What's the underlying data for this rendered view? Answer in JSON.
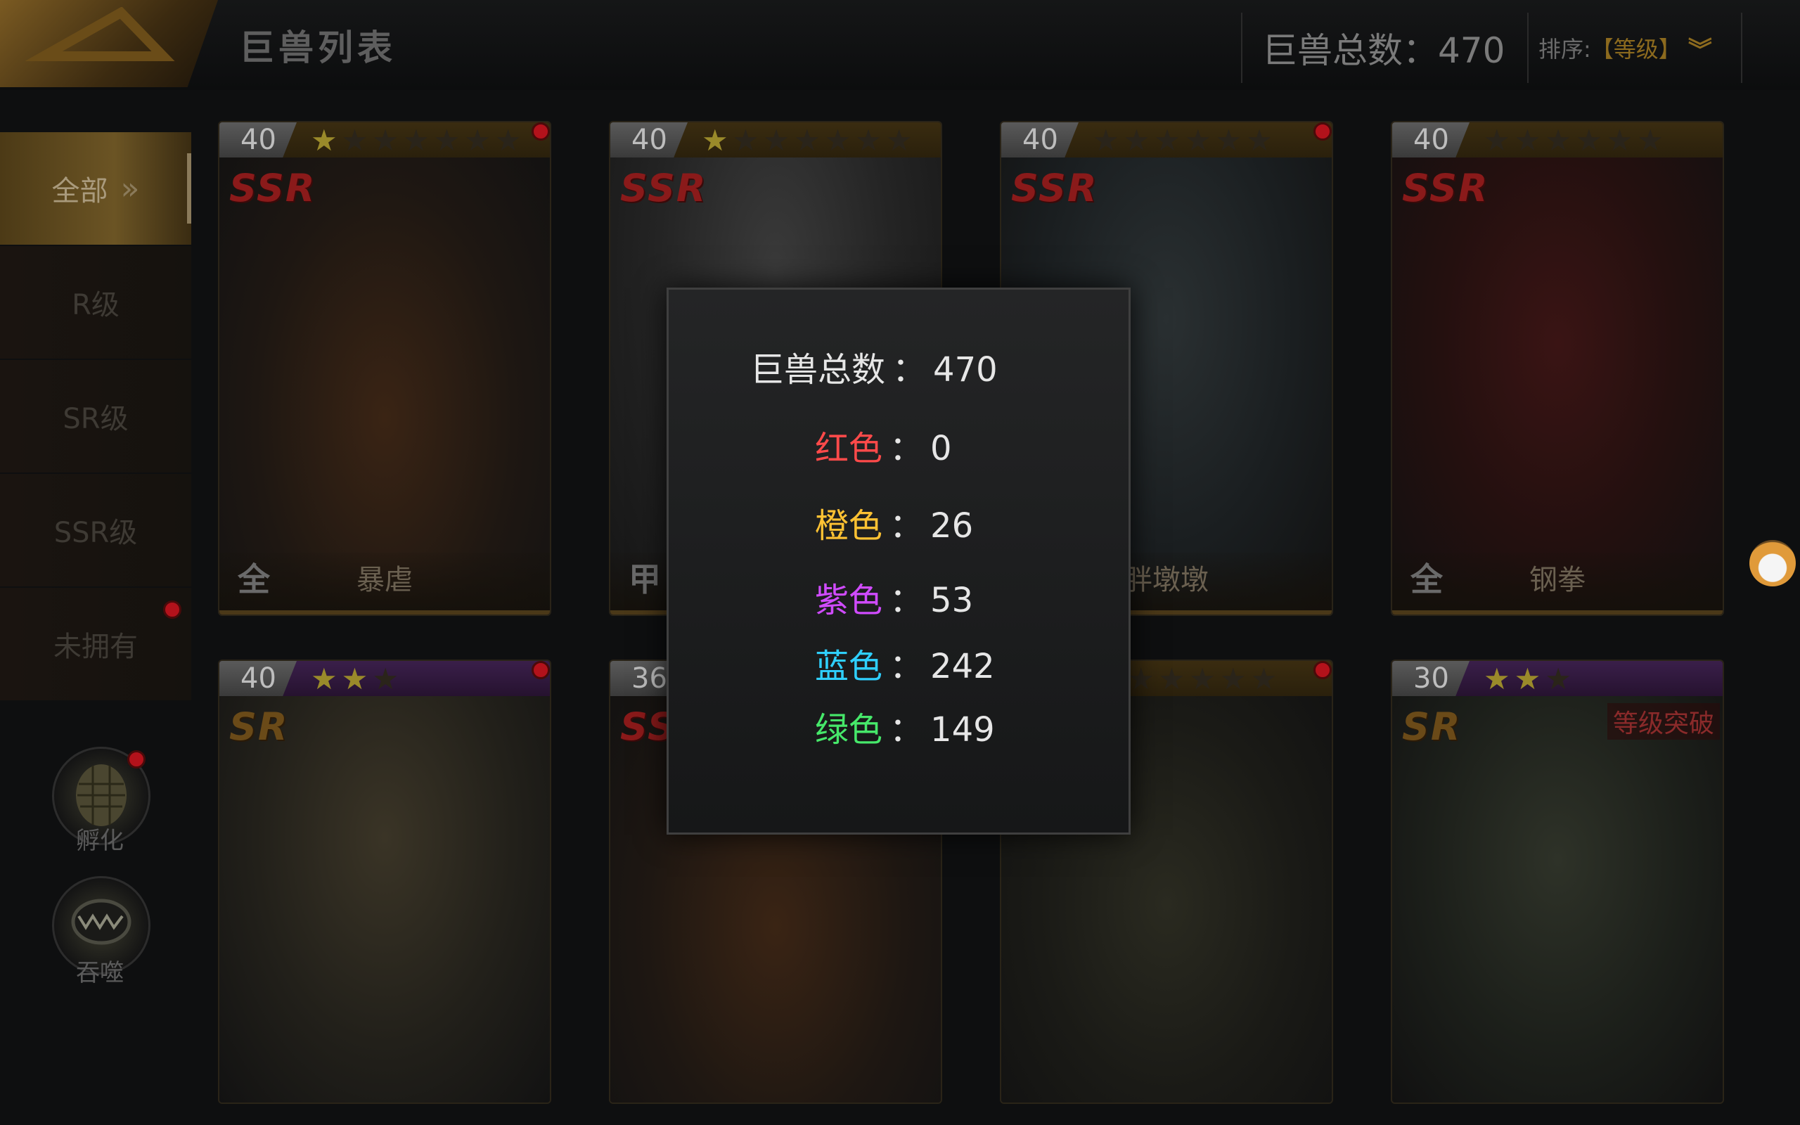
{
  "header": {
    "title": "巨兽列表",
    "total_text": "巨兽总数：470",
    "sort_label": "排序:",
    "sort_value": "【等级】"
  },
  "sidebar": {
    "items": [
      {
        "label": "全部"
      },
      {
        "label": "R级"
      },
      {
        "label": "SR级"
      },
      {
        "label": "SSR级"
      },
      {
        "label": "未拥有"
      }
    ],
    "hatch_label": "孵化",
    "devour_label": "吞噬"
  },
  "cards": [
    {
      "level": "40",
      "rank": "SSR",
      "stars_on": "★",
      "stars_off": "★★★★★★",
      "tag": "全",
      "name": "暴虐"
    },
    {
      "level": "40",
      "rank": "SSR",
      "stars_on": "★",
      "stars_off": "★★★★★★",
      "tag": "甲",
      "name": ""
    },
    {
      "level": "40",
      "rank": "SSR",
      "stars_on": "",
      "stars_off": "★★★★★★",
      "tag": "",
      "name": "胖墩墩"
    },
    {
      "level": "40",
      "rank": "SSR",
      "stars_on": "",
      "stars_off": "★★★★★★",
      "tag": "全",
      "name": "钢拳"
    },
    {
      "level": "40",
      "rank": "SR",
      "stars_on": "★★",
      "stars_off": "★",
      "tag": "",
      "name": ""
    },
    {
      "level": "36",
      "rank": "SSR",
      "stars_on": "",
      "stars_off": "",
      "tag": "",
      "name": ""
    },
    {
      "level": "",
      "rank": "",
      "stars_on": "",
      "stars_off": "★★★★★",
      "tag": "",
      "name": ""
    },
    {
      "level": "30",
      "rank": "SR",
      "stars_on": "★★",
      "stars_off": "★",
      "tag": "",
      "name": "",
      "badge": "等级突破"
    }
  ],
  "popup": {
    "total_label": "巨兽总数",
    "total_value": "470",
    "rows": [
      {
        "label": "红色",
        "value": "0",
        "color": "#ff4a4a"
      },
      {
        "label": "橙色",
        "value": "26",
        "color": "#ffc233"
      },
      {
        "label": "紫色",
        "value": "53",
        "color": "#d04bff"
      },
      {
        "label": "蓝色",
        "value": "242",
        "color": "#2fd0ff"
      },
      {
        "label": "绿色",
        "value": "149",
        "color": "#46e86a"
      }
    ]
  }
}
